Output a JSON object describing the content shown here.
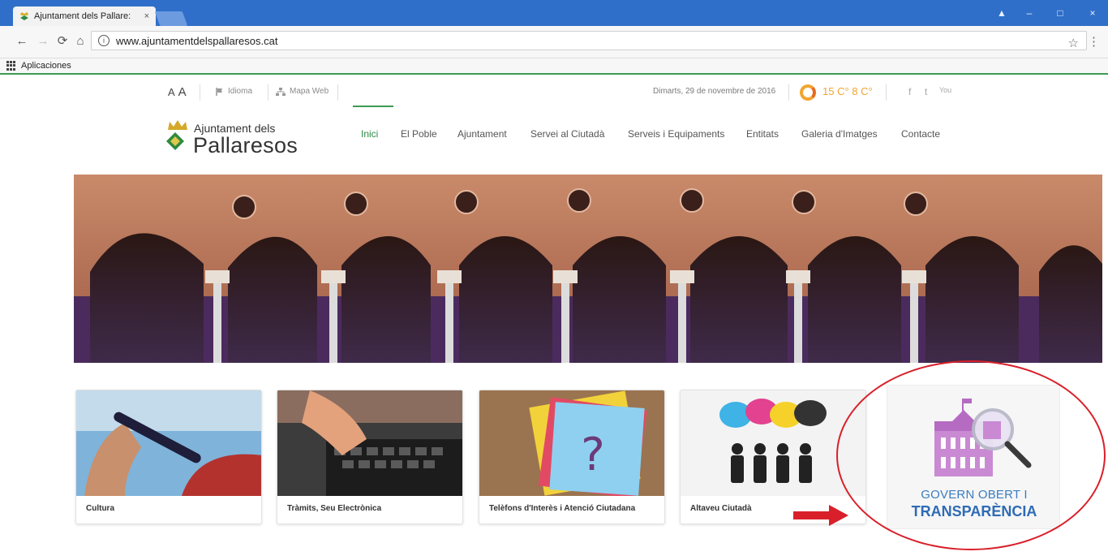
{
  "browser": {
    "tab_title": "Ajuntament dels Pallare:",
    "tab_close": "×",
    "url": "www.ajuntamentdelspallaresos.cat",
    "bookmarks_label": "Aplicaciones",
    "window_controls": {
      "user": "▲",
      "minimize": "–",
      "maximize": "□",
      "close": "×"
    },
    "icons": [
      "back-arrow-icon",
      "forward-arrow-icon",
      "reload-icon",
      "home-icon",
      "info-icon",
      "star-icon",
      "kebab-menu-icon",
      "apps-grid-icon"
    ]
  },
  "site": {
    "utility": {
      "font_small": "A",
      "font_large": "A",
      "idioma": "Idioma",
      "mapa_web": "Mapa Web",
      "date": "Dimarts, 29 de novembre de 2016",
      "temps": "15 C° 8 C°",
      "social": [
        "f",
        "t",
        "You"
      ]
    },
    "logo": {
      "line1": "Ajuntament dels",
      "line2": "Pallaresos"
    },
    "menu": [
      {
        "label": "Inici",
        "active": true
      },
      {
        "label": "El Poble",
        "active": false
      },
      {
        "label": "Ajuntament",
        "active": false
      },
      {
        "label": "Servei al Ciutadà",
        "active": false
      },
      {
        "label": "Serveis i Equipaments",
        "active": false
      },
      {
        "label": "Entitats",
        "active": false
      },
      {
        "label": "Galeria d'Imatges",
        "active": false
      },
      {
        "label": "Contacte",
        "active": false
      }
    ],
    "cards": [
      {
        "label": "Cultura"
      },
      {
        "label": "Tràmits, Seu Electrònica"
      },
      {
        "label": "Telèfons d'Interès i Atenció Ciutadana"
      },
      {
        "label": "Altaveu Ciutadà"
      }
    ],
    "transparencia": {
      "line1": "GOVERN OBERT I",
      "line2": "TRANSPARÈNCIA"
    },
    "colors": {
      "accent_green": "#3c9a52",
      "transparency_blue": "#2f6bb5",
      "annotation_red": "#d9202a"
    }
  }
}
